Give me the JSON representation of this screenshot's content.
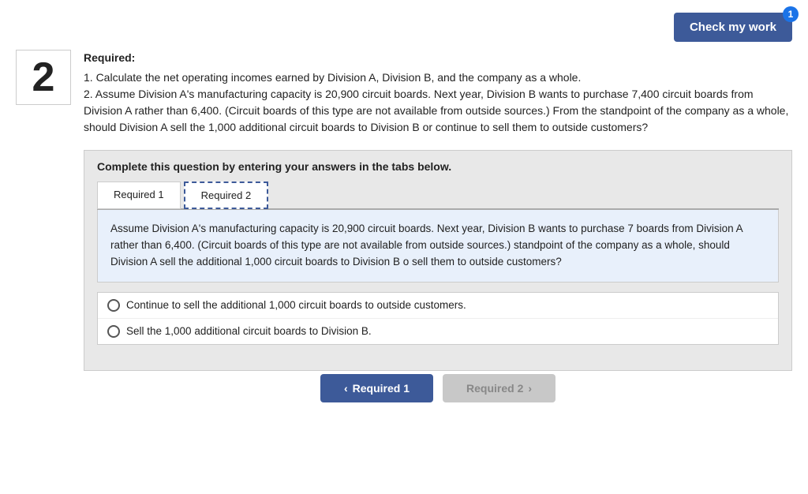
{
  "header": {
    "check_work_label": "Check my work",
    "badge_count": "1"
  },
  "question": {
    "number": "2",
    "required_label": "Required:",
    "instruction_1": "1. Calculate the net operating incomes earned by Division A, Division B, and the company as a whole.",
    "instruction_2": "2. Assume Division A's manufacturing capacity is 20,900 circuit boards. Next year, Division B wants to purchase 7,400 circuit boards from Division A rather than 6,400. (Circuit boards of this type are not available from outside sources.) From the standpoint of the company as a whole, should Division A sell the 1,000 additional circuit boards to Division B or continue to sell them to outside customers?"
  },
  "complete_box": {
    "title": "Complete this question by entering your answers in the tabs below."
  },
  "tabs": [
    {
      "label": "Required 1",
      "active": false
    },
    {
      "label": "Required 2",
      "active": true
    }
  ],
  "tab_content": "Assume Division A's manufacturing capacity is 20,900 circuit boards. Next year, Division B wants to purchase 7 boards from Division A rather than 6,400. (Circuit boards of this type are not available from outside sources.) standpoint of the company as a whole, should Division A sell the additional 1,000 circuit boards to Division B o sell them to outside customers?",
  "answer_options": [
    {
      "id": "opt1",
      "label": "Continue to sell the additional 1,000 circuit boards to outside customers."
    },
    {
      "id": "opt2",
      "label": "Sell the 1,000 additional circuit boards to Division B."
    }
  ],
  "nav": {
    "prev_label": "Required 1",
    "prev_icon": "‹",
    "next_label": "Required 2",
    "next_icon": "›"
  }
}
